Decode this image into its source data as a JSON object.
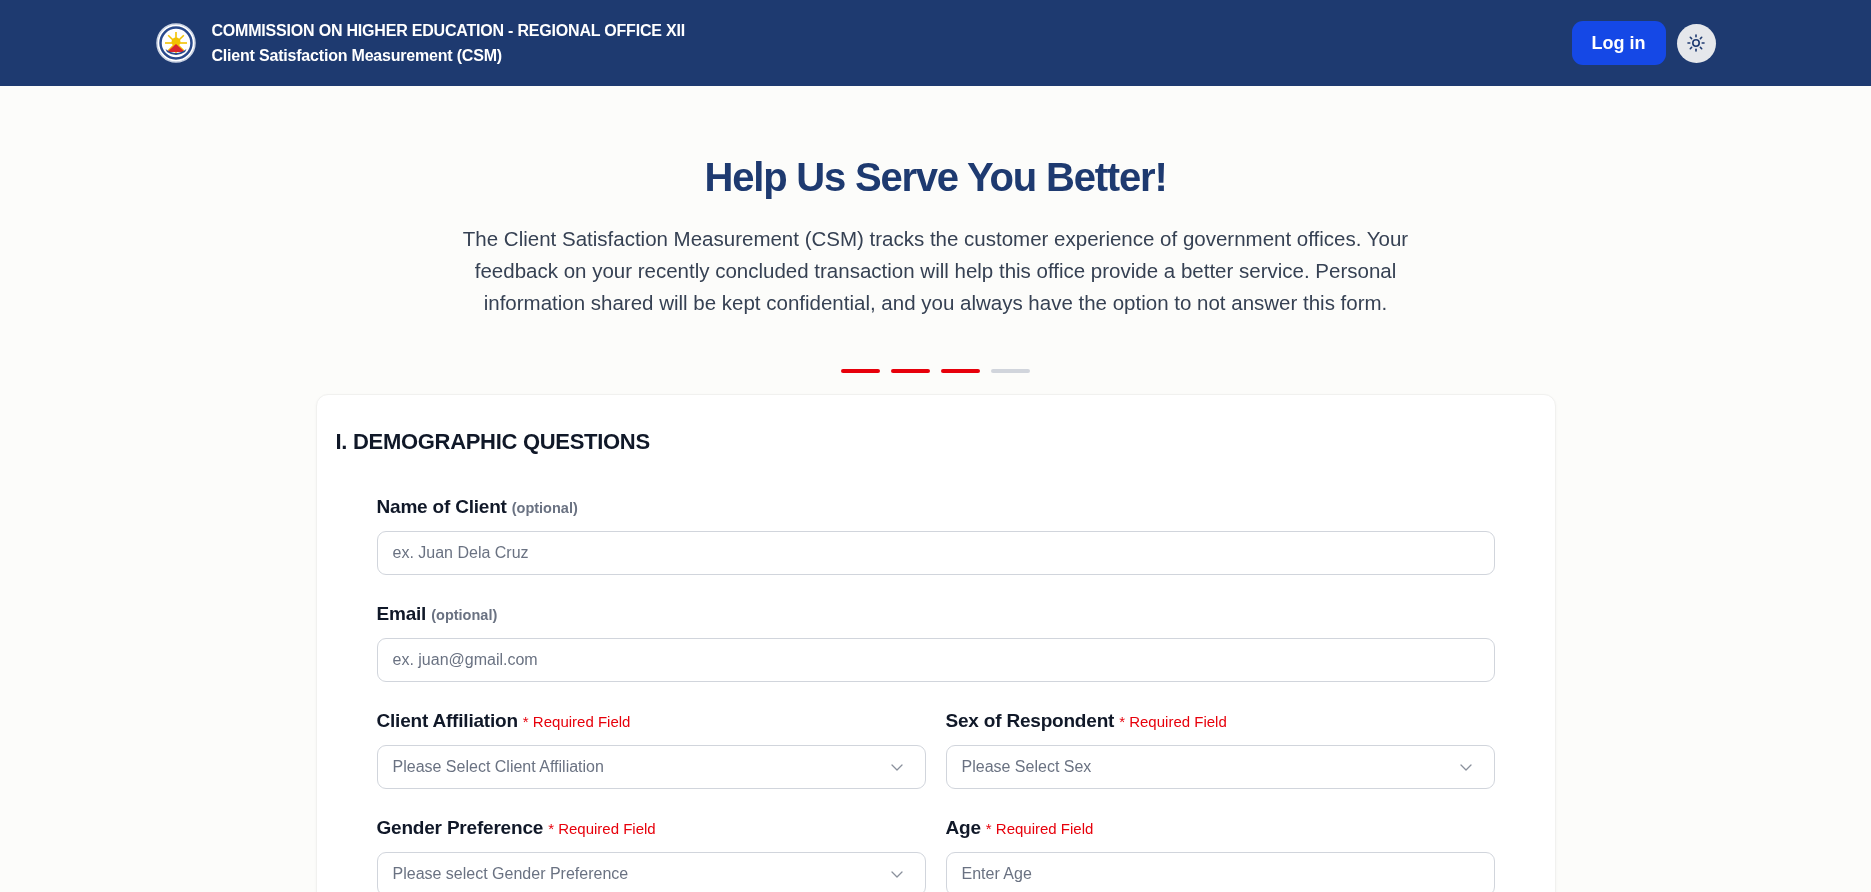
{
  "header": {
    "title": "COMMISSION ON HIGHER EDUCATION - REGIONAL OFFICE XII",
    "subtitle": "Client Satisfaction Measurement (CSM)",
    "login_button": "Log in"
  },
  "hero": {
    "heading": "Help Us Serve You Better!",
    "description": "The Client Satisfaction Measurement (CSM) tracks the customer experience of government offices. Your feedback on your recently concluded transaction will help this office provide a better service. Personal information shared will be kept confidential, and you always have the option to not answer this form."
  },
  "progress": {
    "steps": [
      {
        "completed": true
      },
      {
        "completed": true
      },
      {
        "completed": true
      },
      {
        "completed": false
      }
    ]
  },
  "section": {
    "title": "I. DEMOGRAPHIC QUESTIONS",
    "rows": [
      [
        {
          "label": "Name of Client",
          "note": "(optional)",
          "required": false,
          "kind": "text",
          "placeholder": "ex. Juan Dela Cruz"
        }
      ],
      [
        {
          "label": "Email",
          "note": "(optional)",
          "required": false,
          "kind": "text",
          "placeholder": "ex. juan@gmail.com"
        }
      ],
      [
        {
          "label": "Client Affiliation",
          "note": "* Required Field",
          "required": true,
          "kind": "select",
          "placeholder": "Please Select Client Affiliation"
        },
        {
          "label": "Sex of Respondent",
          "note": "* Required Field",
          "required": true,
          "kind": "select",
          "placeholder": "Please Select Sex"
        }
      ],
      [
        {
          "label": "Gender Preference",
          "note": "* Required Field",
          "required": true,
          "kind": "select",
          "placeholder": "Please select Gender Preference"
        },
        {
          "label": "Age",
          "note": "* Required Field",
          "required": true,
          "kind": "text",
          "placeholder": "Enter Age"
        }
      ]
    ]
  }
}
